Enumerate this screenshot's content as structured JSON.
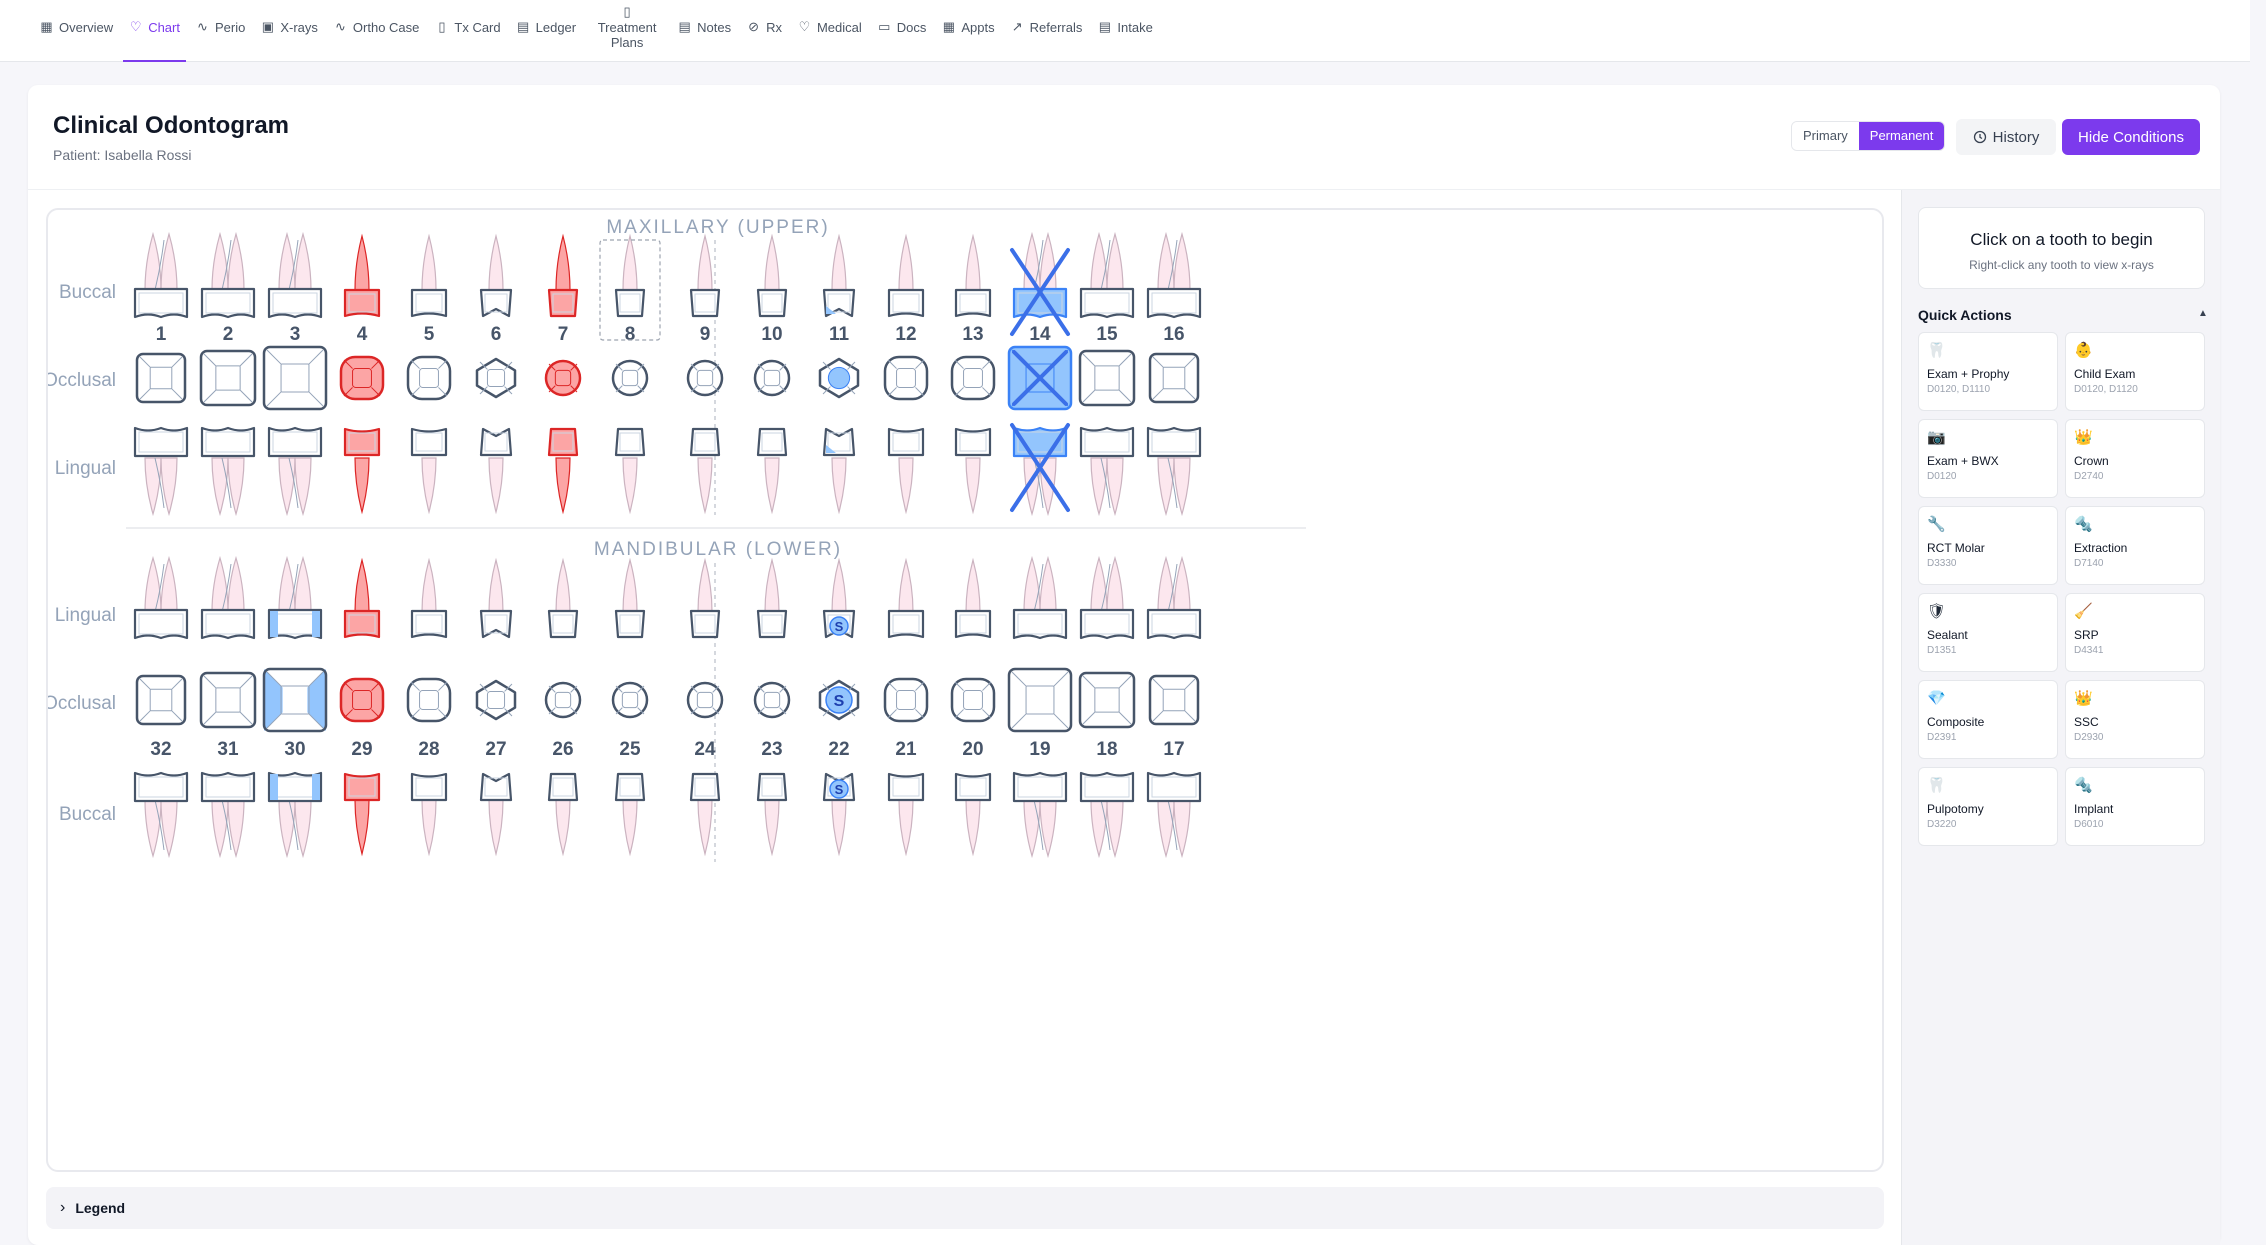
{
  "nav": {
    "tabs": [
      {
        "label": "Overview",
        "icon": "grid-icon",
        "glyph": "▦"
      },
      {
        "label": "Chart",
        "icon": "tooth-icon",
        "glyph": "♡",
        "active": true
      },
      {
        "label": "Perio",
        "icon": "pulse-icon",
        "glyph": "∿"
      },
      {
        "label": "X-rays",
        "icon": "image-icon",
        "glyph": "▣"
      },
      {
        "label": "Ortho Case",
        "icon": "activity-icon",
        "glyph": "∿"
      },
      {
        "label": "Tx Card",
        "icon": "clipboard-icon",
        "glyph": "▯"
      },
      {
        "label": "Ledger",
        "icon": "ledger-icon",
        "glyph": "▤"
      },
      {
        "label": "Treatment Plans",
        "icon": "document-icon",
        "glyph": "▯",
        "stacked": true
      },
      {
        "label": "Notes",
        "icon": "notes-icon",
        "glyph": "▤"
      },
      {
        "label": "Rx",
        "icon": "pill-icon",
        "glyph": "⊘"
      },
      {
        "label": "Medical",
        "icon": "heart-icon",
        "glyph": "♡"
      },
      {
        "label": "Docs",
        "icon": "folder-icon",
        "glyph": "▭"
      },
      {
        "label": "Appts",
        "icon": "calendar-icon",
        "glyph": "▦"
      },
      {
        "label": "Referrals",
        "icon": "external-link-icon",
        "glyph": "↗"
      },
      {
        "label": "Intake",
        "icon": "clipboard-list-icon",
        "glyph": "▤"
      }
    ]
  },
  "header": {
    "title": "Clinical Odontogram",
    "patient": "Patient: Isabella Rossi",
    "dentition_primary": "Primary",
    "dentition_permanent": "Permanent",
    "dentition_selected": "Permanent",
    "history_label": "History",
    "hide_conditions_label": "Hide Conditions"
  },
  "chart": {
    "upper_heading": "MAXILLARY (UPPER)",
    "lower_heading": "MANDIBULAR (LOWER)",
    "row_labels": {
      "buccal": "Buccal",
      "occlusal": "Occlusal",
      "lingual": "Lingual"
    },
    "colors": {
      "outline": "#475569",
      "root_fill": "#fce7ee",
      "root_stroke": "#cbb3c0",
      "condition_red_fill": "#fca5a5",
      "condition_red_stroke": "#dc2626",
      "condition_blue_fill": "#93c5fd",
      "condition_blue_stroke": "#3b82f6",
      "missing_x": "#3b6fe8",
      "heading": "#94a3b8"
    },
    "upper_teeth": [
      {
        "number": "1",
        "type": "molar"
      },
      {
        "number": "2",
        "type": "molar"
      },
      {
        "number": "3",
        "type": "molar"
      },
      {
        "number": "4",
        "type": "premolar",
        "condition": "red"
      },
      {
        "number": "5",
        "type": "premolar"
      },
      {
        "number": "6",
        "type": "canine"
      },
      {
        "number": "7",
        "type": "incisor",
        "condition": "red"
      },
      {
        "number": "8",
        "type": "incisor",
        "selected": true
      },
      {
        "number": "9",
        "type": "incisor"
      },
      {
        "number": "10",
        "type": "incisor"
      },
      {
        "number": "11",
        "type": "canine",
        "condition": "blue-partial"
      },
      {
        "number": "12",
        "type": "premolar"
      },
      {
        "number": "13",
        "type": "premolar"
      },
      {
        "number": "14",
        "type": "molar",
        "condition": "missing"
      },
      {
        "number": "15",
        "type": "molar"
      },
      {
        "number": "16",
        "type": "molar"
      }
    ],
    "lower_teeth": [
      {
        "number": "32",
        "type": "molar"
      },
      {
        "number": "31",
        "type": "molar"
      },
      {
        "number": "30",
        "type": "molar",
        "condition": "blue-mesial-distal"
      },
      {
        "number": "29",
        "type": "premolar",
        "condition": "red"
      },
      {
        "number": "28",
        "type": "premolar"
      },
      {
        "number": "27",
        "type": "canine"
      },
      {
        "number": "26",
        "type": "incisor"
      },
      {
        "number": "25",
        "type": "incisor"
      },
      {
        "number": "24",
        "type": "incisor"
      },
      {
        "number": "23",
        "type": "incisor"
      },
      {
        "number": "22",
        "type": "canine",
        "condition": "sealant",
        "mark": "S"
      },
      {
        "number": "21",
        "type": "premolar"
      },
      {
        "number": "20",
        "type": "premolar"
      },
      {
        "number": "19",
        "type": "molar"
      },
      {
        "number": "18",
        "type": "molar"
      },
      {
        "number": "17",
        "type": "molar"
      }
    ]
  },
  "sidebar": {
    "hint_title": "Click on a tooth to begin",
    "hint_sub": "Right-click any tooth to view x-rays",
    "quick_actions_title": "Quick Actions",
    "toggle_glyph": "▲",
    "actions": [
      {
        "name": "Exam + Prophy",
        "codes": "D0120, D1110",
        "icon": "tooth-icon",
        "glyph": "🦷"
      },
      {
        "name": "Child Exam",
        "codes": "D0120, D1120",
        "icon": "child-icon",
        "glyph": "👶"
      },
      {
        "name": "Exam + BWX",
        "codes": "D0120",
        "icon": "camera-icon",
        "glyph": "📷"
      },
      {
        "name": "Crown",
        "codes": "D2740",
        "icon": "crown-icon",
        "glyph": "👑"
      },
      {
        "name": "RCT Molar",
        "codes": "D3330",
        "icon": "wrench-icon",
        "glyph": "🔧"
      },
      {
        "name": "Extraction",
        "codes": "D7140",
        "icon": "forceps-icon",
        "glyph": "🔩"
      },
      {
        "name": "Sealant",
        "codes": "D1351",
        "icon": "shield-icon",
        "glyph": "🛡"
      },
      {
        "name": "SRP",
        "codes": "D4341",
        "icon": "broom-icon",
        "glyph": "🧹"
      },
      {
        "name": "Composite",
        "codes": "D2391",
        "icon": "gem-icon",
        "glyph": "💎"
      },
      {
        "name": "SSC",
        "codes": "D2930",
        "icon": "crown-icon",
        "glyph": "👑"
      },
      {
        "name": "Pulpotomy",
        "codes": "D3220",
        "icon": "tooth-icon",
        "glyph": "🦷"
      },
      {
        "name": "Implant",
        "codes": "D6010",
        "icon": "screw-icon",
        "glyph": "🔩"
      }
    ]
  },
  "legend": {
    "label": "Legend",
    "glyph": "›"
  }
}
